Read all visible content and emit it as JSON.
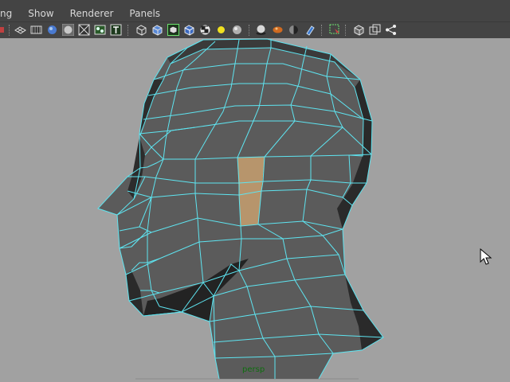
{
  "menubar": {
    "items": [
      {
        "id": "lighting",
        "label": "ng"
      },
      {
        "id": "show",
        "label": "Show"
      },
      {
        "id": "renderer",
        "label": "Renderer"
      },
      {
        "id": "panels",
        "label": "Panels"
      }
    ]
  },
  "toolbar": {
    "icons": [
      "camera-attributes-icon",
      "grid-toggle-icon",
      "film-gate-icon",
      "smooth-shade-icon",
      "flat-shade-icon",
      "xray-icon",
      "texture-icon",
      "text-label-icon",
      "wireframe-cube-icon",
      "shaded-cube-icon",
      "wireframe-on-shaded-icon",
      "default-material-icon",
      "checker-texture-icon",
      "default-light-icon",
      "gray-sphere-icon",
      "shadow-sphere-icon",
      "bump-sphere-icon",
      "hdr-sphere-icon",
      "glass-cylinder-icon",
      "select-region-icon",
      "isolate-select-icon",
      "bounding-box-icon",
      "share-nodes-icon"
    ]
  },
  "viewport": {
    "camera_label": "persp",
    "mesh_color": "#5a5a5a",
    "wire_color": "#5ee4f0",
    "selection_color": "#c89a6a",
    "background_color": "#a1a1a1"
  }
}
